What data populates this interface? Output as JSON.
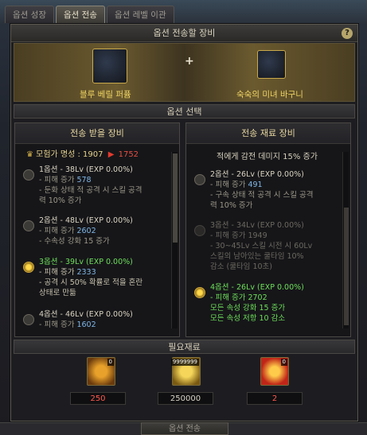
{
  "tabs": [
    "옵션 성장",
    "옵션 전송",
    "옵션 레벨 이관"
  ],
  "panel": {
    "title": "옵션 전송할 장비",
    "help": "?"
  },
  "items": {
    "left_name": "블루 베릴 퍼퓸",
    "right_name": "숙숙의 미녀 바구니",
    "plus": "+"
  },
  "sections": {
    "option_select": "옵션 선택",
    "required": "필요재료"
  },
  "receive": {
    "title": "전송 받을 장비",
    "adventurer": {
      "label": "모험가 명성 : 1907",
      "arrow": "▶",
      "target": "1752"
    },
    "options": [
      {
        "title": "1옵션 - 38Lv (EXP 0.00%)",
        "dmg_label": "- 피해 증가",
        "dmg_value": "578",
        "sub": [
          "- 둔화 상태 적 공격 시 스킬 공격",
          "력 10% 증가"
        ]
      },
      {
        "title": "2옵션 - 48Lv (EXP 0.00%)",
        "dmg_label": "- 피해 증가",
        "dmg_value": "2602",
        "sub": [
          "- 수속성 강화 15 증가"
        ]
      },
      {
        "title": "3옵션 - 39Lv (EXP 0.00%)",
        "dmg_label": "- 피해 증가",
        "dmg_value": "2333",
        "sub": [
          "- 공격 시 50% 확률로 적을 혼란",
          "상태로 만듦"
        ]
      },
      {
        "title": "4옵션 - 46Lv (EXP 0.00%)",
        "dmg_label": "- 피해 증가",
        "dmg_value": "1602",
        "sub": []
      }
    ]
  },
  "material": {
    "title": "전송 재료 장비",
    "top_text": "적에게 감전 데미지 15% 증가",
    "options": [
      {
        "title": "2옵션 - 26Lv (EXP 0.00%)",
        "dmg_label": "- 피해 증가",
        "dmg_value": "491",
        "sub": [
          "- 구속 상태 적 공격 시 스킬 공격",
          "력 10% 증가"
        ]
      },
      {
        "title": "3옵션 - 34Lv (EXP 0.00%)",
        "dmg_label": "- 피해 증가",
        "dmg_value": "1949",
        "sub": [
          "- 30~45Lv 스킬 시전 시 60Lv",
          "스킬의 남아있는 쿨타임 10%",
          "감소 (쿨타임 10초)"
        ]
      },
      {
        "title": "4옵션 - 26Lv (EXP 0.00%)",
        "dmg_label": "- 피해 증가",
        "dmg_value": "2702",
        "sub": [
          "모든 속성 강화 15 증가",
          "모든 속성 저항 10 감소"
        ]
      }
    ]
  },
  "required": [
    {
      "badge": "0",
      "count": "250",
      "color": "#ff5a4e"
    },
    {
      "badge": "9999999",
      "count": "250000",
      "color": "#d8d4c6"
    },
    {
      "badge": "0",
      "count": "2",
      "color": "#ff5a4e"
    }
  ],
  "bottom": {
    "button": "옵션 전송"
  },
  "icons": {
    "adventurer": "trophy-icon",
    "help": "question-icon"
  }
}
